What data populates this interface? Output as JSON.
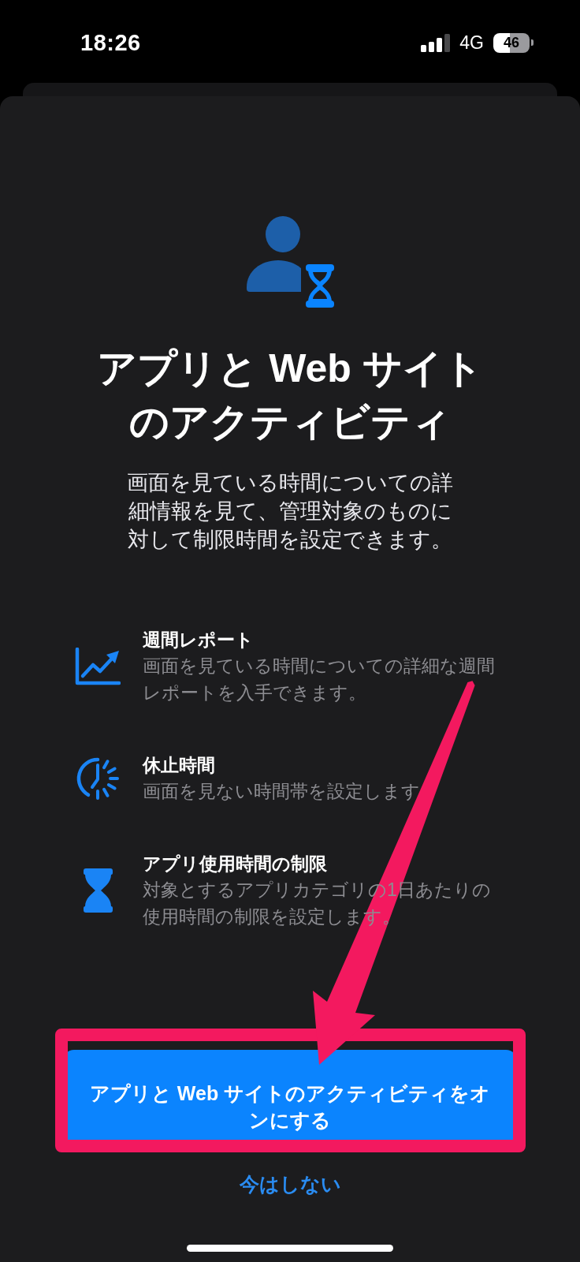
{
  "status_bar": {
    "time": "18:26",
    "network": "4G",
    "battery": "46"
  },
  "sheet": {
    "title": "アプリと Web サイトのアクティビティ",
    "description": "画面を見ている時間についての詳細情報を見て、管理対象のものに対して制限時間を設定できます。",
    "features": [
      {
        "kind": "report",
        "title": "週間レポート",
        "description": "画面を見ている時間についての詳細な週間レポートを入手できます。"
      },
      {
        "kind": "downtime",
        "title": "休止時間",
        "description": "画面を見ない時間帯を設定します"
      },
      {
        "kind": "limit",
        "title": "アプリ使用時間の制限",
        "description": "対象とするアプリカテゴリの1日あたりの使用時間の制限を設定します。"
      }
    ],
    "primary_button": "アプリと Web サイトのアクティビティをオンにする",
    "secondary_button": "今はしない"
  },
  "callout": {
    "frame": true,
    "arrow": true
  }
}
